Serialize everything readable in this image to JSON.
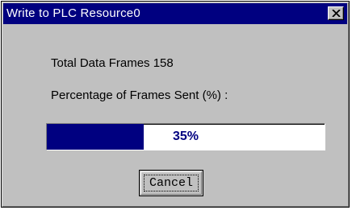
{
  "window": {
    "title": "Write to PLC Resource0",
    "close_icon": "close-icon"
  },
  "info": {
    "total_label": "Total Data Frames 158",
    "percentage_label": "Percentage of Frames Sent (%) :"
  },
  "progress": {
    "value_percent": 35,
    "label": "35%",
    "fill_color": "#000080"
  },
  "buttons": {
    "cancel_label": "Cancel"
  },
  "colors": {
    "titlebar": "#000080",
    "dialog_face": "#c0c0c0"
  }
}
